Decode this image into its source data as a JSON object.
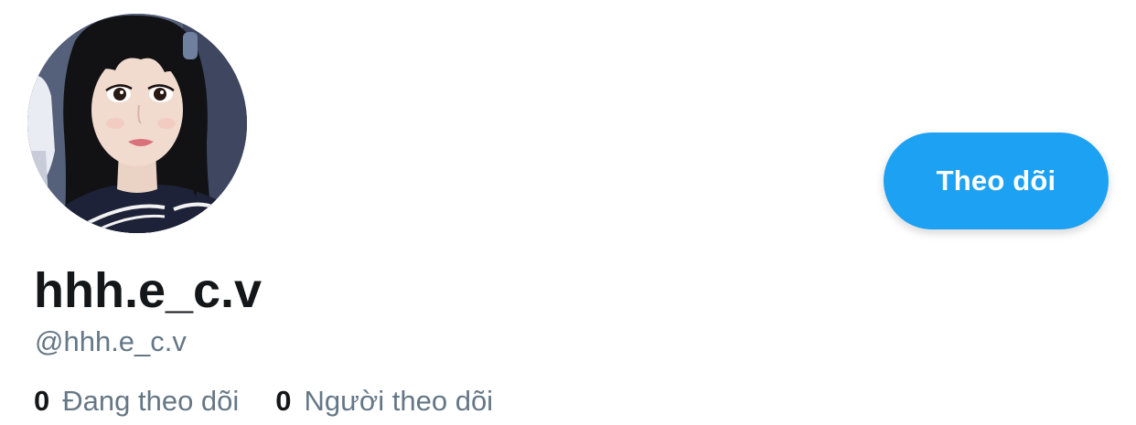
{
  "profile": {
    "display_name": "hhh.e_c.v",
    "handle": "@hhh.e_c.v",
    "avatar_alt": "profile photo"
  },
  "actions": {
    "follow_label": "Theo dõi"
  },
  "stats": {
    "following_count": "0",
    "following_label": "Đang theo dõi",
    "followers_count": "0",
    "followers_label": "Người theo dõi"
  },
  "colors": {
    "accent": "#1da1f2",
    "primary_text": "#14171a",
    "secondary_text": "#657786",
    "background": "#ffffff"
  }
}
